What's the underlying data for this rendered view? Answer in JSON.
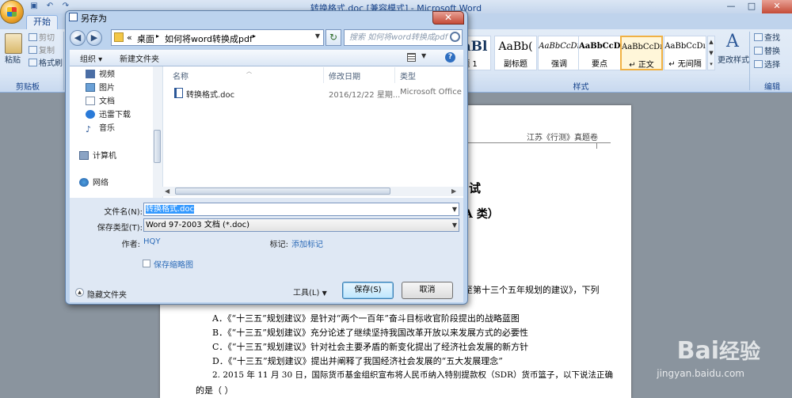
{
  "window": {
    "title": "转换格式.doc [兼容模式] - Microsoft Word",
    "controls": {
      "minimize": "—",
      "maximize": "□",
      "close": "✕"
    }
  },
  "ribbon": {
    "tabs": [
      "开始"
    ],
    "clipboard": {
      "paste": "粘贴",
      "cut": "剪切",
      "copy": "复制",
      "format_painter": "格式刷",
      "group": "剪贴板"
    },
    "styles": [
      {
        "sample": "AaBl",
        "name": "题 1"
      },
      {
        "sample": "AaBb(",
        "name": "副标题"
      },
      {
        "sample": "AaBbCcDı",
        "name": "强调"
      },
      {
        "sample": "AaBbCcD",
        "name": "要点"
      },
      {
        "sample": "AaBbCcDı",
        "name": "↵ 正文"
      },
      {
        "sample": "AaBbCcDı",
        "name": "↵ 无间隔"
      }
    ],
    "change_styles": "更改样式",
    "styles_group": "样式",
    "editing": {
      "find": "查找",
      "replace": "替换",
      "select": "选择",
      "group": "编辑"
    }
  },
  "document": {
    "header_text": "江苏《行测》真题卷",
    "title_fragment_1": "试",
    "title_fragment_2": "A 类）",
    "para1_tail": "至第十三个五年规划的建议》，下列",
    "options": [
      "A．《“十三五”规划建议》是针对“两个一百年”奋斗目标收官阶段提出的战略蓝图",
      "B．《“十三五”规划建议》充分论述了继续坚持我国改革开放以来发展方式的必要性",
      "C．《“十三五”规划建议》针对社会主要矛盾的新变化提出了经济社会发展的新方针",
      "D．《“十三五”规划建议》提出并阐释了我国经济社会发展的“五大发展理念”"
    ],
    "question2_line1": "2. 2015 年 11 月 30 日，国际货币基金组织宣布将人民币纳入特别提款权（SDR）货币篮子，以下说法正确",
    "question2_line2": "的是（    ）"
  },
  "dialog": {
    "title": "另存为",
    "breadcrumb": {
      "prefix": "«",
      "root": "桌面",
      "sep": "▸",
      "folder": "如何将word转换成pdf",
      "arrow": "▸"
    },
    "search_placeholder": "搜索 如何将word转换成pdf",
    "toolbar": {
      "organize": "组织 ▾",
      "new_folder": "新建文件夹"
    },
    "nav_items": [
      {
        "label": "视频",
        "icon": "video-icon"
      },
      {
        "label": "图片",
        "icon": "picture-icon"
      },
      {
        "label": "文档",
        "icon": "document-icon"
      },
      {
        "label": "迅雷下载",
        "icon": "download-icon"
      },
      {
        "label": "音乐",
        "icon": "music-icon"
      },
      {
        "label": "计算机",
        "icon": "computer-icon"
      },
      {
        "label": "网络",
        "icon": "network-icon"
      }
    ],
    "columns": [
      "名称",
      "修改日期",
      "类型"
    ],
    "files": [
      {
        "name": "转换格式.doc",
        "date": "2016/12/22 星期...",
        "type": "Microsoft Office..."
      }
    ],
    "filename_label": "文件名(N):",
    "filename_value": "转换格式.doc",
    "filetype_label": "保存类型(T):",
    "filetype_value": "Word 97-2003 文档 (*.doc)",
    "author_label": "作者:",
    "author_value": "HQY",
    "tags_label": "标记:",
    "tags_value": "添加标记",
    "thumbnail_label": "保存缩略图",
    "hide_folders": "隐藏文件夹",
    "tools": "工具(L)",
    "save": "保存(S)",
    "cancel": "取消"
  },
  "watermark": {
    "brand": "Bai",
    "brand2": "经验",
    "url": "jingyan.baidu.com"
  }
}
